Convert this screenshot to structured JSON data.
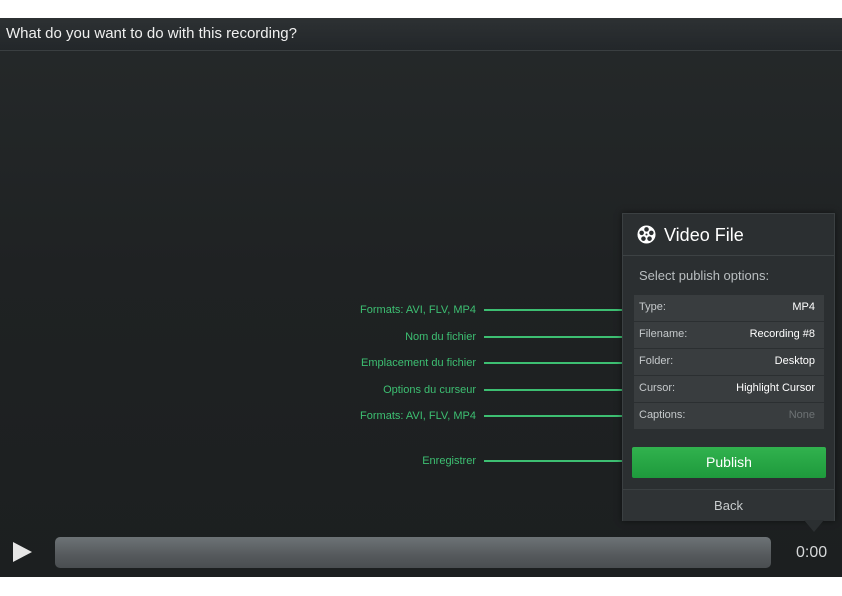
{
  "window": {
    "title": "What do you want to do with this recording?"
  },
  "panel": {
    "icon": "film-reel-icon",
    "title": "Video File",
    "subtitle": "Select publish options:",
    "options": [
      {
        "key": "Type:",
        "value": "MP4"
      },
      {
        "key": "Filename:",
        "value": "Recording #8"
      },
      {
        "key": "Folder:",
        "value": "Desktop"
      },
      {
        "key": "Cursor:",
        "value": "Highlight Cursor"
      },
      {
        "key": "Captions:",
        "value": "None"
      }
    ],
    "publish_label": "Publish",
    "back_label": "Back"
  },
  "annotations": [
    "Formats: AVI, FLV, MP4",
    "Nom du fichier",
    "Emplacement du fichier",
    "Options du curseur",
    "Formats: AVI, FLV, MP4",
    "Enregistrer"
  ],
  "player": {
    "time": "0:00",
    "play_icon": "play-icon"
  },
  "colors": {
    "accent_green": "#3dbf72",
    "publish_green": "#22a443"
  }
}
